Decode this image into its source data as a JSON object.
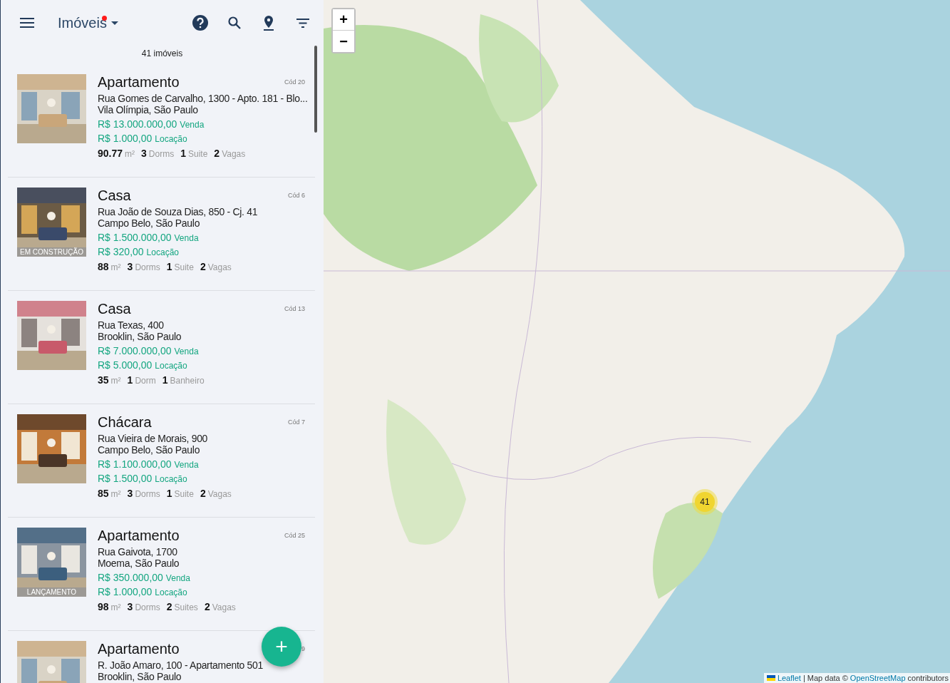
{
  "header": {
    "title": "Imóveis",
    "has_notification": true
  },
  "count": "41 imóveis",
  "listings": [
    {
      "type": "Apartamento",
      "code": "Cód 20",
      "address": "Rua Gomes de Carvalho, 1300 - Apto. 181 - Blo...",
      "area": "Vila Olímpia, São Paulo",
      "prices": [
        {
          "value": "R$ 13.000.000,00",
          "label": "Venda"
        },
        {
          "value": "R$ 1.000,00",
          "label": "Locação"
        }
      ],
      "stats": [
        {
          "value": "90.77",
          "unit": "m²"
        },
        {
          "value": "3",
          "unit": "Dorms"
        },
        {
          "value": "1",
          "unit": "Suite"
        },
        {
          "value": "2",
          "unit": "Vagas"
        }
      ]
    },
    {
      "type": "Casa",
      "code": "Cód 6",
      "address": "Rua João de Souza Dias, 850 - Cj. 41",
      "area": "Campo Belo, São Paulo",
      "badge": "EM CONSTRUÇÃO",
      "prices": [
        {
          "value": "R$ 1.500.000,00",
          "label": "Venda"
        },
        {
          "value": "R$ 320,00",
          "label": "Locação"
        }
      ],
      "stats": [
        {
          "value": "88",
          "unit": "m²"
        },
        {
          "value": "3",
          "unit": "Dorms"
        },
        {
          "value": "1",
          "unit": "Suite"
        },
        {
          "value": "2",
          "unit": "Vagas"
        }
      ]
    },
    {
      "type": "Casa",
      "code": "Cód 13",
      "address": "Rua Texas, 400",
      "area": "Brooklin, São Paulo",
      "prices": [
        {
          "value": "R$ 7.000.000,00",
          "label": "Venda"
        },
        {
          "value": "R$ 5.000,00",
          "label": "Locação"
        }
      ],
      "stats": [
        {
          "value": "35",
          "unit": "m²"
        },
        {
          "value": "1",
          "unit": "Dorm"
        },
        {
          "value": "1",
          "unit": "Banheiro"
        }
      ]
    },
    {
      "type": "Chácara",
      "code": "Cód 7",
      "address": "Rua Vieira de Morais, 900",
      "area": "Campo Belo, São Paulo",
      "prices": [
        {
          "value": "R$ 1.100.000,00",
          "label": "Venda"
        },
        {
          "value": "R$ 1.500,00",
          "label": "Locação"
        }
      ],
      "stats": [
        {
          "value": "85",
          "unit": "m²"
        },
        {
          "value": "3",
          "unit": "Dorms"
        },
        {
          "value": "1",
          "unit": "Suite"
        },
        {
          "value": "2",
          "unit": "Vagas"
        }
      ]
    },
    {
      "type": "Apartamento",
      "code": "Cód 25",
      "address": "Rua Gaivota, 1700",
      "area": "Moema, São Paulo",
      "badge": "LANÇAMENTO",
      "prices": [
        {
          "value": "R$ 350.000,00",
          "label": "Venda"
        },
        {
          "value": "R$ 1.000,00",
          "label": "Locação"
        }
      ],
      "stats": [
        {
          "value": "98",
          "unit": "m²"
        },
        {
          "value": "3",
          "unit": "Dorms"
        },
        {
          "value": "2",
          "unit": "Suites"
        },
        {
          "value": "2",
          "unit": "Vagas"
        }
      ]
    },
    {
      "type": "Apartamento",
      "code": "9",
      "address": "R. João Amaro, 100 - Apartamento 501",
      "area": "Brooklin, São Paulo"
    }
  ],
  "map": {
    "zoom_in": "+",
    "zoom_out": "−",
    "cluster": "41",
    "attribution": {
      "link1": "Leaflet",
      "middle": "| Map data ©",
      "link2": "OpenStreetMap",
      "end": "contributors"
    }
  },
  "fab": "+"
}
